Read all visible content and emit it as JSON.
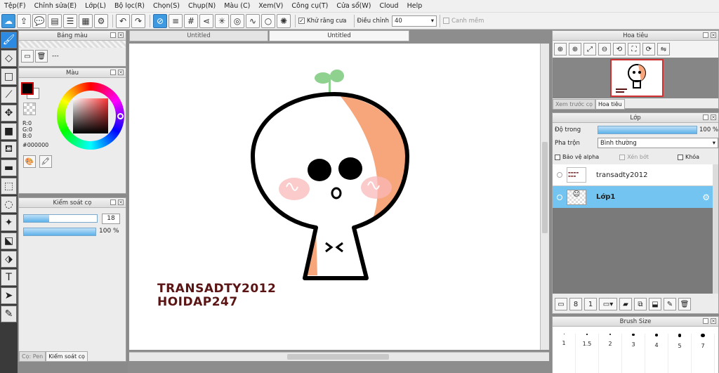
{
  "menu": [
    "Tệp(F)",
    "Chỉnh sửa(E)",
    "Lớp(L)",
    "Bộ lọc(R)",
    "Chọn(S)",
    "Chụp(N)",
    "Màu (C)",
    "Xem(V)",
    "Công cụ(T)",
    "Cửa sổ(W)",
    "Cloud",
    "Help"
  ],
  "toolbar": {
    "antialias_label": "Khử răng cưa",
    "adjust_label": "Điều chỉnh",
    "adjust_value": "40",
    "smooth_label": "Canh mềm"
  },
  "tabs": {
    "tab1": "Untitled",
    "tab2": "Untitled"
  },
  "swatch_panel": {
    "title": "Bảng màu",
    "dash": "---"
  },
  "color_panel": {
    "title": "Màu",
    "r": "R:0",
    "g": "G:0",
    "b": "B:0",
    "hex": "#000000",
    "fg": "#000000",
    "bg": "#ffffff"
  },
  "brush_panel": {
    "title": "Kiểm soát cọ",
    "size": "18",
    "opacity": "100 %",
    "size_fraction": 0.35,
    "opacity_fraction": 1.0,
    "tab_pen": "Cọ: Pen",
    "tab_ctrl": "Kiểm soát cọ"
  },
  "navigator": {
    "title": "Hoa tiêu",
    "tab_preview": "Xem trước cọ",
    "tab_nav": "Hoa tiêu"
  },
  "layer_panel": {
    "title": "Lớp",
    "opacity_label": "Độ trong",
    "opacity_value": "100 %",
    "blend_label": "Pha trộn",
    "blend_value": "Bình thường",
    "protect_alpha": "Bảo vệ alpha",
    "clipping": "Xén bớt",
    "lock": "Khóa",
    "layers": [
      {
        "name": "transadty2012"
      },
      {
        "name": "Lớp1",
        "selected": true
      }
    ]
  },
  "brushsize": {
    "title": "Brush Size",
    "sizes": [
      "1",
      "1.5",
      "2",
      "3",
      "4",
      "5",
      "7"
    ]
  },
  "artwork": {
    "line1": "TRANSADTY2012",
    "line2": "HOIDAP247",
    "accent": "#f7a57a",
    "sprout": "#8fd18f",
    "blush": "#f9b8b8"
  },
  "colors": {
    "accent": "#3d9ae0",
    "selected_layer": "#73c4f0"
  }
}
